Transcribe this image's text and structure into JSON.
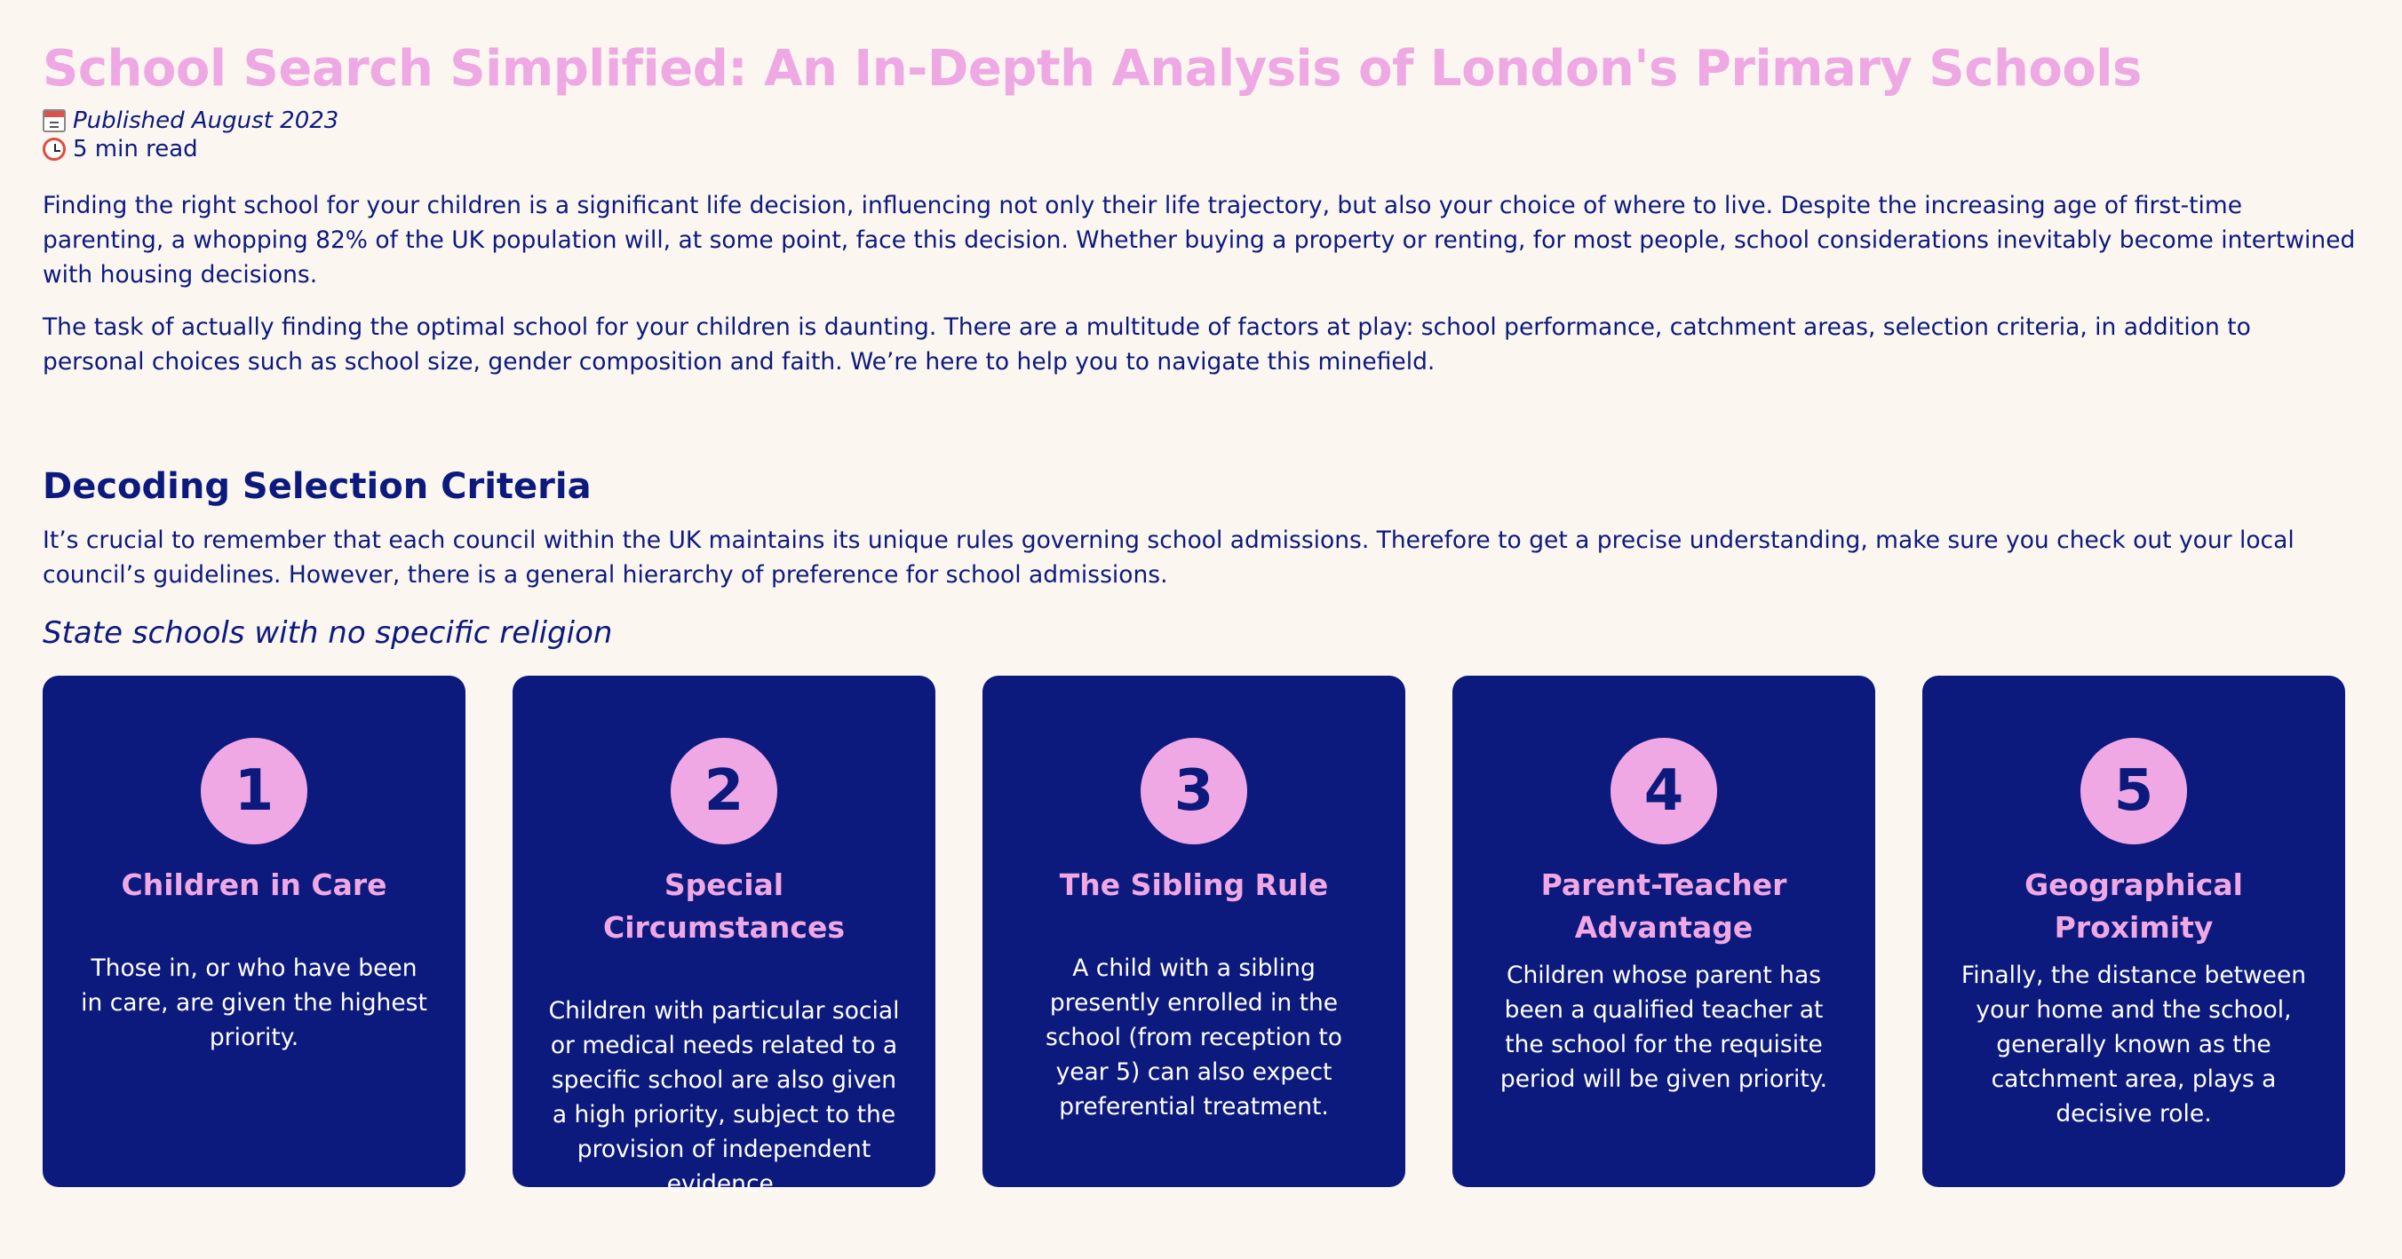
{
  "article": {
    "title": "School Search Simplified: An In-Depth Analysis of London's Primary Schools",
    "published": "Published August 2023",
    "read_time": "5 min read",
    "intro_p1": "Finding the right school for your children is a significant life decision, influencing not only their life trajectory, but also your choice of where to live. Despite the increasing age of first-time parenting, a whopping 82% of the UK population will, at some point, face this decision. Whether buying a property or renting, for most people, school considerations inevitably become intertwined with housing decisions.",
    "intro_p2": "The task of actually finding the optimal school for your children is daunting. There are a multitude of factors at play: school performance, catchment areas, selection criteria, in addition to personal choices such as school size, gender composition and faith. We’re here to help you to navigate this minefield.",
    "icons": {
      "published": "calendar-icon",
      "read_time": "alarm-clock-icon"
    }
  },
  "section": {
    "heading": "Decoding Selection Criteria",
    "body": "It’s crucial to remember that each council within the UK maintains its unique rules governing school admissions. Therefore to get a precise understanding, make sure you check out your local council’s guidelines. However, there is a general hierarchy of preference for school admissions.",
    "subheading": "State schools with no specific religion",
    "cards": [
      {
        "number": "1",
        "title": "Children in Care",
        "text": "Those in, or who have been in care, are given the highest priority."
      },
      {
        "number": "2",
        "title": "Special Circumstances",
        "text": "Children with particular social or medical needs related to a specific school are also given a high priority, subject to the provision of independent evidence."
      },
      {
        "number": "3",
        "title": "The Sibling Rule",
        "text": "A child with a sibling presently enrolled in the school (from reception to year 5) can also expect preferential treatment."
      },
      {
        "number": "4",
        "title": "Parent-Teacher Advantage",
        "text": "Children whose parent has been a qualified teacher at the school for the requisite period will be given priority."
      },
      {
        "number": "5",
        "title": "Geographical Proximity",
        "text": "Finally, the distance between your home and the school, generally known as the catchment area, plays a decisive role."
      }
    ]
  },
  "colors": {
    "background": "#fbf6f0",
    "primary": "#0c1a7d",
    "accent_pink": "#eea8e3",
    "card_text": "#ffffff"
  }
}
